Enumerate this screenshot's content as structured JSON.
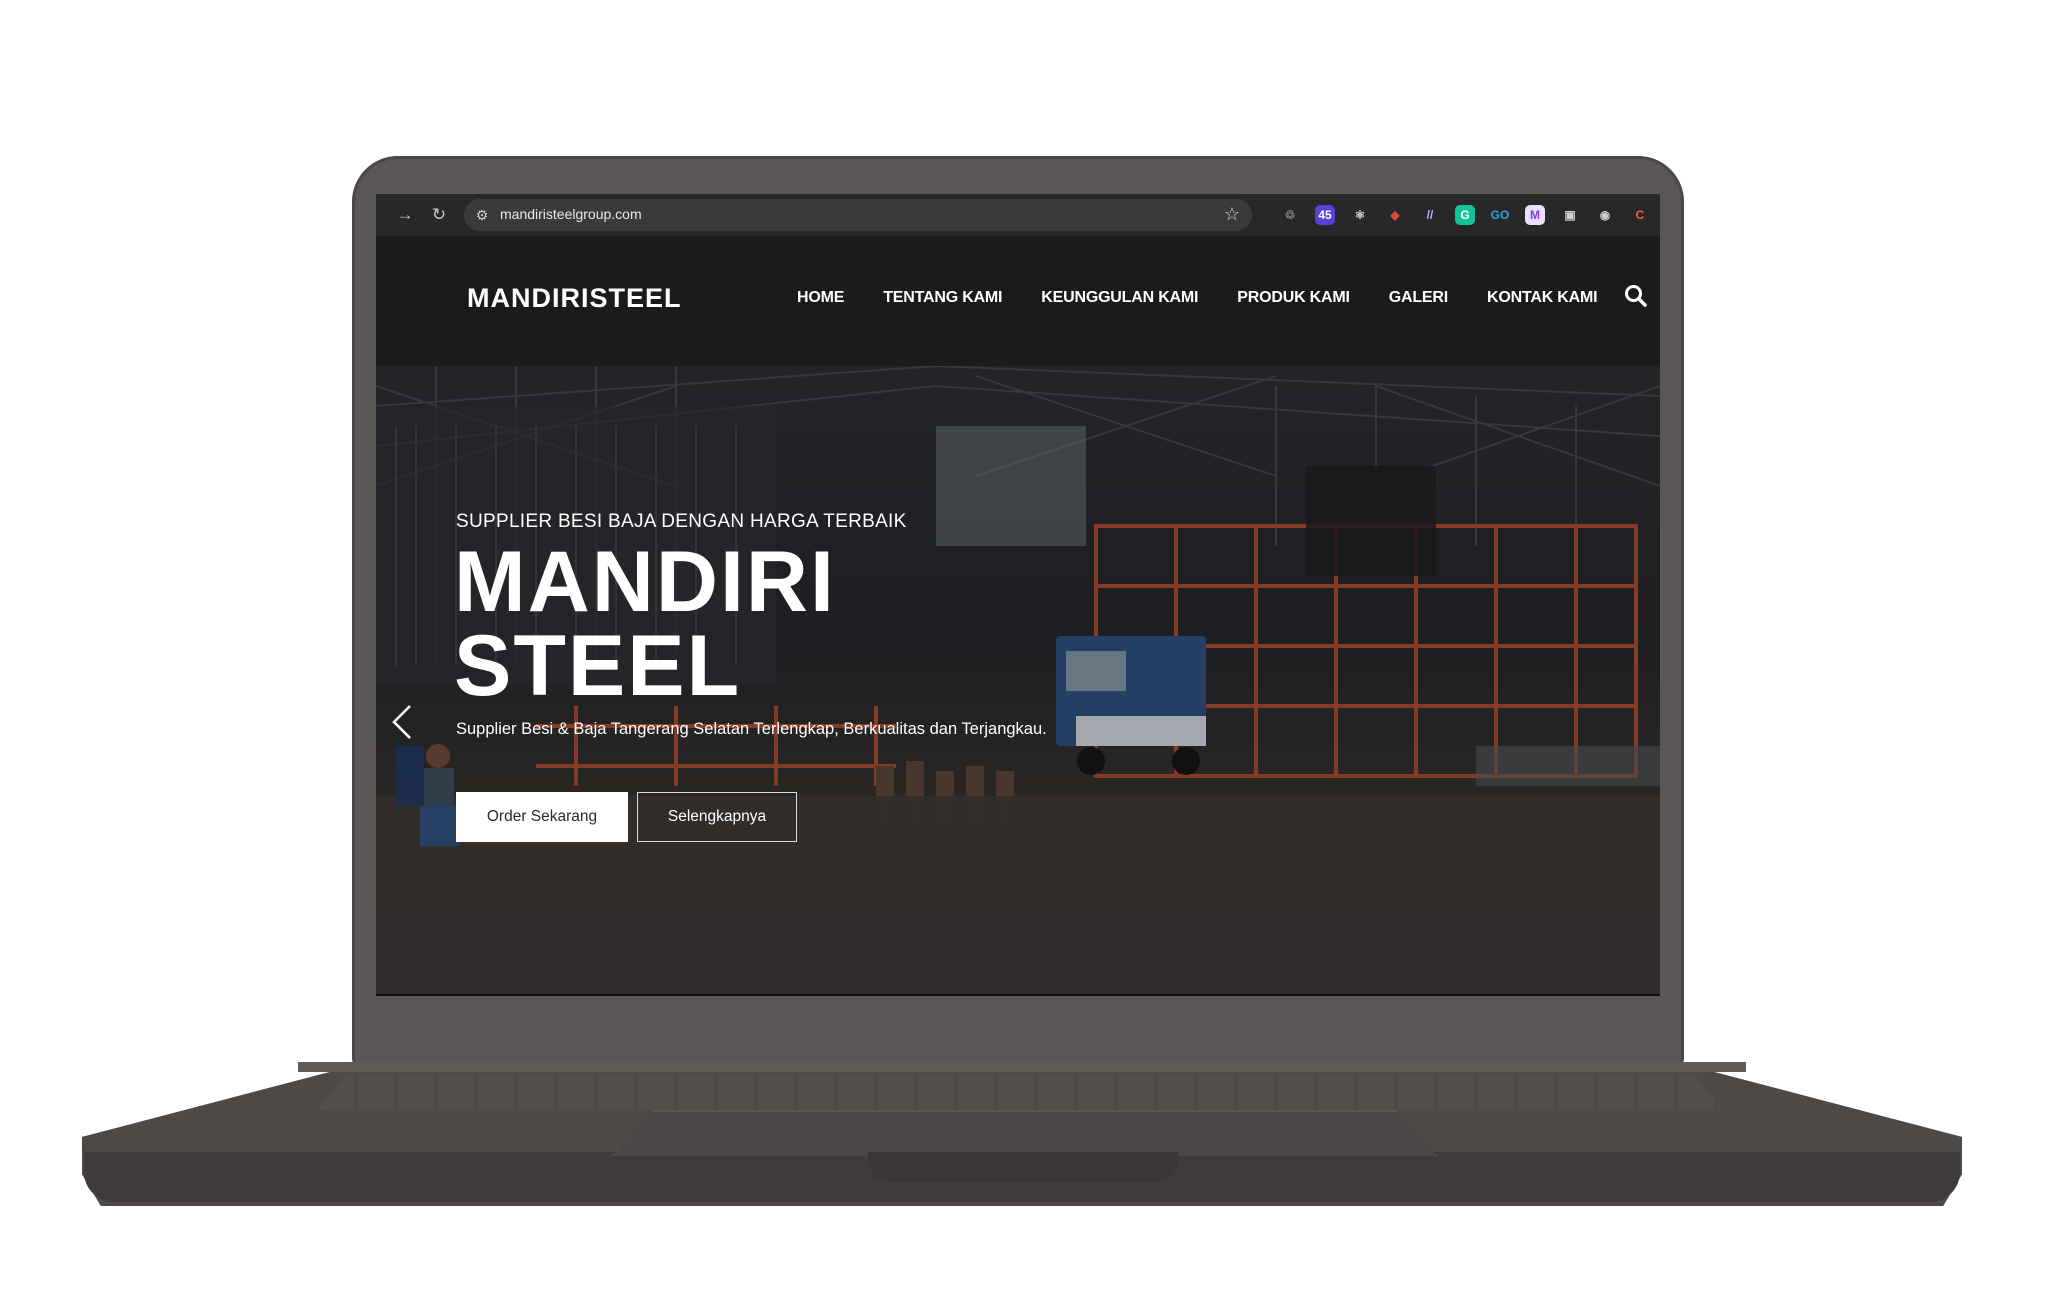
{
  "browser": {
    "url": "mandiristeelgroup.com",
    "extensions": [
      {
        "name": "recycle-extension-icon",
        "glyph": "♲",
        "color": "#8a8a8a",
        "bg": "transparent"
      },
      {
        "name": "badge-extension-icon",
        "glyph": "45",
        "color": "#ffffff",
        "bg": "#5b3fd6"
      },
      {
        "name": "react-extension-icon",
        "glyph": "⚛",
        "color": "#d8d8d8",
        "bg": "transparent"
      },
      {
        "name": "color-extension-icon",
        "glyph": "◆",
        "color": "#e0483c",
        "bg": "transparent"
      },
      {
        "name": "wave-extension-icon",
        "glyph": "//",
        "color": "#b5b5ff",
        "bg": "transparent"
      },
      {
        "name": "grammarly-extension-icon",
        "glyph": "G",
        "color": "#ffffff",
        "bg": "#15c39a"
      },
      {
        "name": "go-extension-icon",
        "glyph": "GO",
        "color": "#2aa3e0",
        "bg": "transparent"
      },
      {
        "name": "mail-extension-icon",
        "glyph": "M",
        "color": "#8a3bd6",
        "bg": "#e8e0ff"
      },
      {
        "name": "page-extension-icon",
        "glyph": "▣",
        "color": "#cfcfcf",
        "bg": "transparent"
      },
      {
        "name": "camera-extension-icon",
        "glyph": "◉",
        "color": "#cfcfcf",
        "bg": "transparent"
      },
      {
        "name": "c-extension-icon",
        "glyph": "C",
        "color": "#ff5a2a",
        "bg": "transparent"
      }
    ]
  },
  "site": {
    "logo": "MANDIRISTEEL",
    "nav": [
      "HOME",
      "TENTANG KAMI",
      "KEUNGGULAN KAMI",
      "PRODUK KAMI",
      "GALERI",
      "KONTAK KAMI"
    ]
  },
  "hero": {
    "kicker": "SUPPLIER BESI BAJA DENGAN HARGA TERBAIK",
    "title_line1": "MANDIRI",
    "title_line2": "STEEL",
    "subtitle": "Supplier Besi & Baja Tangerang Selatan Terlengkap, Berkualitas dan Terjangkau.",
    "primary_button": "Order Sekarang",
    "secondary_button": "Selengkapnya"
  }
}
